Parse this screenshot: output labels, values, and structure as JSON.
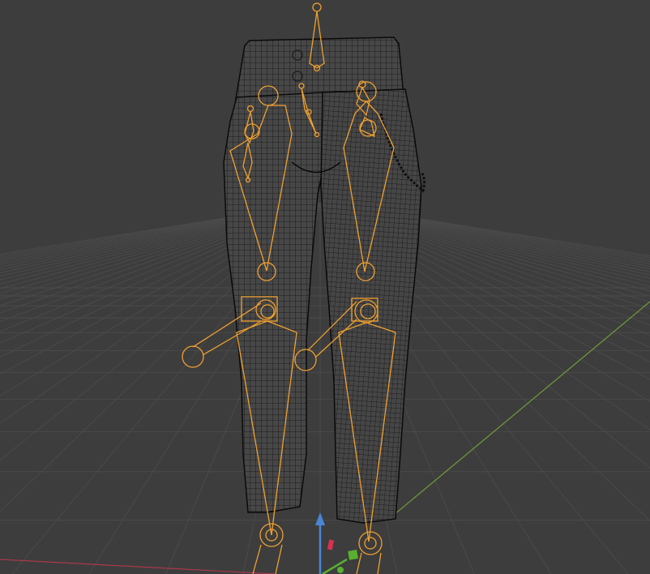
{
  "viewport": {
    "mode": "3d-viewport-wireframe",
    "background_color": "#3d3d3d",
    "grid_color": "#4a4a4a",
    "axis_x_color": "#a83a4a",
    "axis_y_color": "#6f9a3a",
    "axis_z_color": "#4a86d4"
  },
  "mesh": {
    "name": "pants-mesh",
    "wire_color": "#0e0e0e",
    "fill_color": "#494949"
  },
  "armature": {
    "name": "leg-armature",
    "bone_color": "#f0a030",
    "bones": [
      "spine-bone",
      "hip-bone",
      "thigh-left",
      "thigh-right",
      "shin-left",
      "shin-right",
      "knee-pole-left",
      "knee-pole-right",
      "foot-left",
      "foot-right",
      "pocket-bone-left",
      "pocket-bone-right"
    ]
  },
  "gizmo": {
    "label": "transform-gizmo",
    "z_handle_color": "#4a86d4",
    "x_handle_color": "#d83050",
    "y_handle_color": "#58b030"
  }
}
